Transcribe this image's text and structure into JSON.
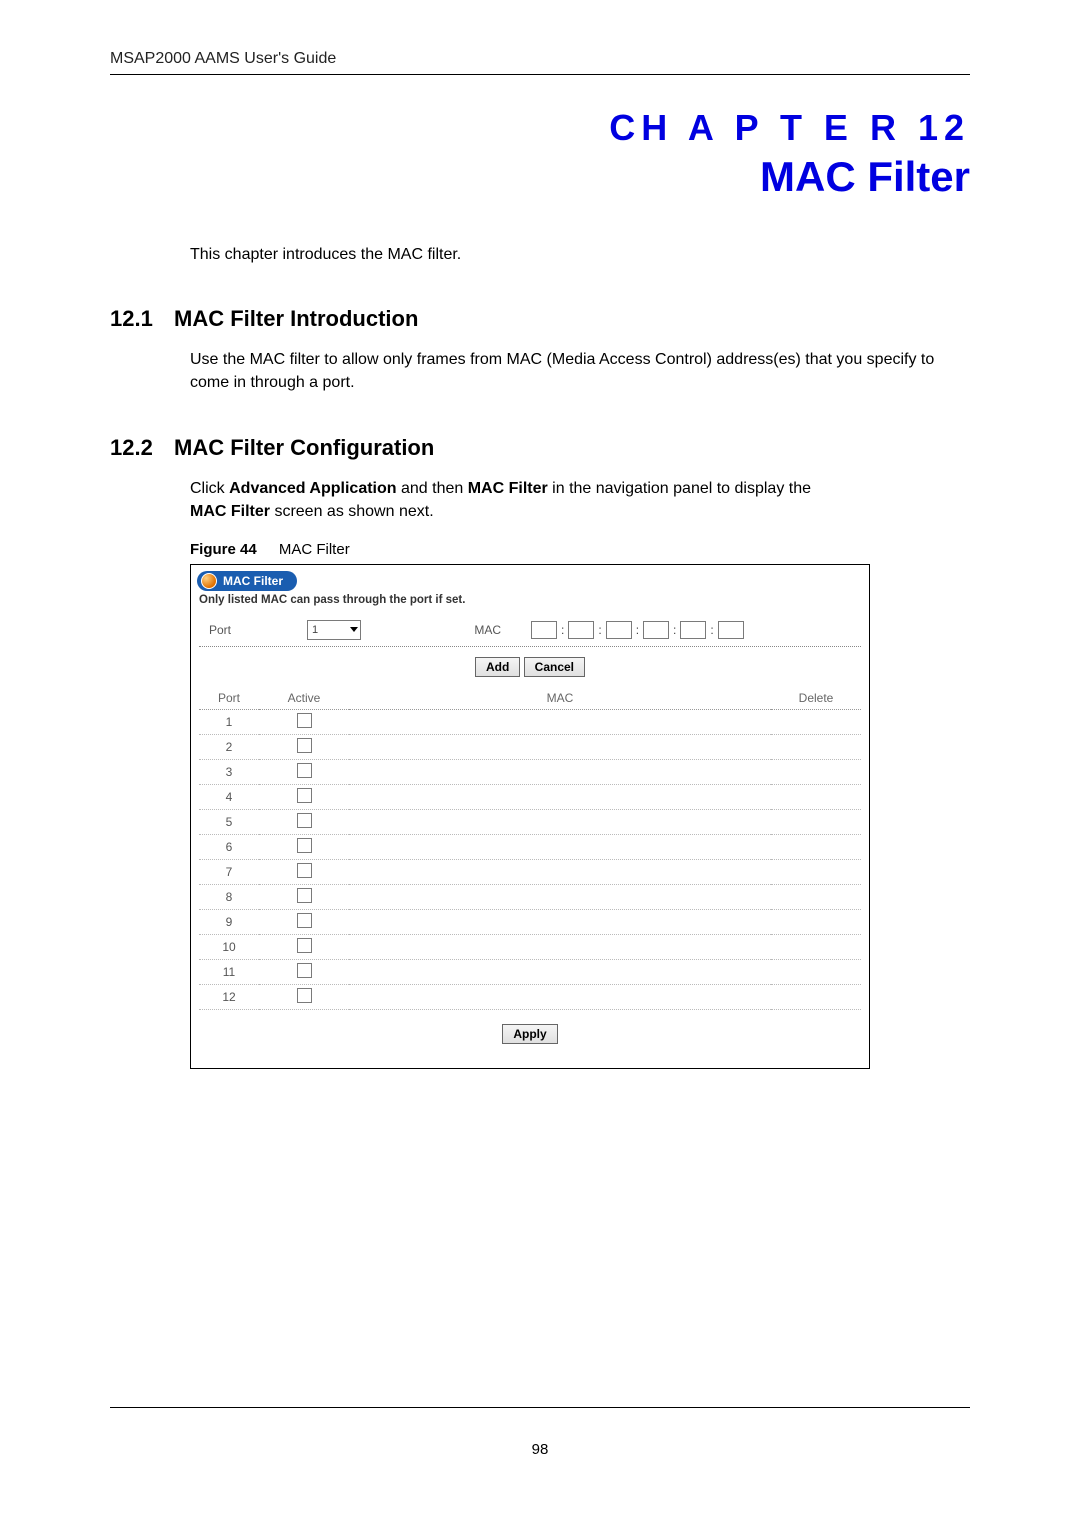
{
  "header": {
    "guide_title": "MSAP2000 AAMS User's Guide"
  },
  "chapter": {
    "overline": "CH A P T E R  12",
    "title": "MAC Filter",
    "intro": "This chapter introduces the MAC filter."
  },
  "sections": {
    "s1": {
      "num": "12.1",
      "title": "MAC Filter Introduction",
      "body": "Use the MAC filter to allow only frames from MAC (Media Access Control) address(es) that you specify to come in through a port."
    },
    "s2": {
      "num": "12.2",
      "title": "MAC Filter Configuration",
      "body_pre": "Click ",
      "body_b1": "Advanced Application",
      "body_mid": " and then ",
      "body_b2": "MAC Filter",
      "body_post": " in the navigation panel to display the",
      "body_line2_b": "MAC Filter",
      "body_line2_rest": " screen as shown next."
    }
  },
  "figure": {
    "label": "Figure 44",
    "caption": "MAC Filter",
    "toolbar_title": "MAC Filter",
    "hint": "Only listed MAC can pass through the port if set.",
    "port_label": "Port",
    "port_value": "1",
    "mac_label": "MAC",
    "add_label": "Add",
    "cancel_label": "Cancel",
    "apply_label": "Apply",
    "columns": {
      "port": "Port",
      "active": "Active",
      "mac": "MAC",
      "delete": "Delete"
    },
    "rows": [
      {
        "port": "1"
      },
      {
        "port": "2"
      },
      {
        "port": "3"
      },
      {
        "port": "4"
      },
      {
        "port": "5"
      },
      {
        "port": "6"
      },
      {
        "port": "7"
      },
      {
        "port": "8"
      },
      {
        "port": "9"
      },
      {
        "port": "10"
      },
      {
        "port": "11"
      },
      {
        "port": "12"
      }
    ]
  },
  "page_number": "98"
}
